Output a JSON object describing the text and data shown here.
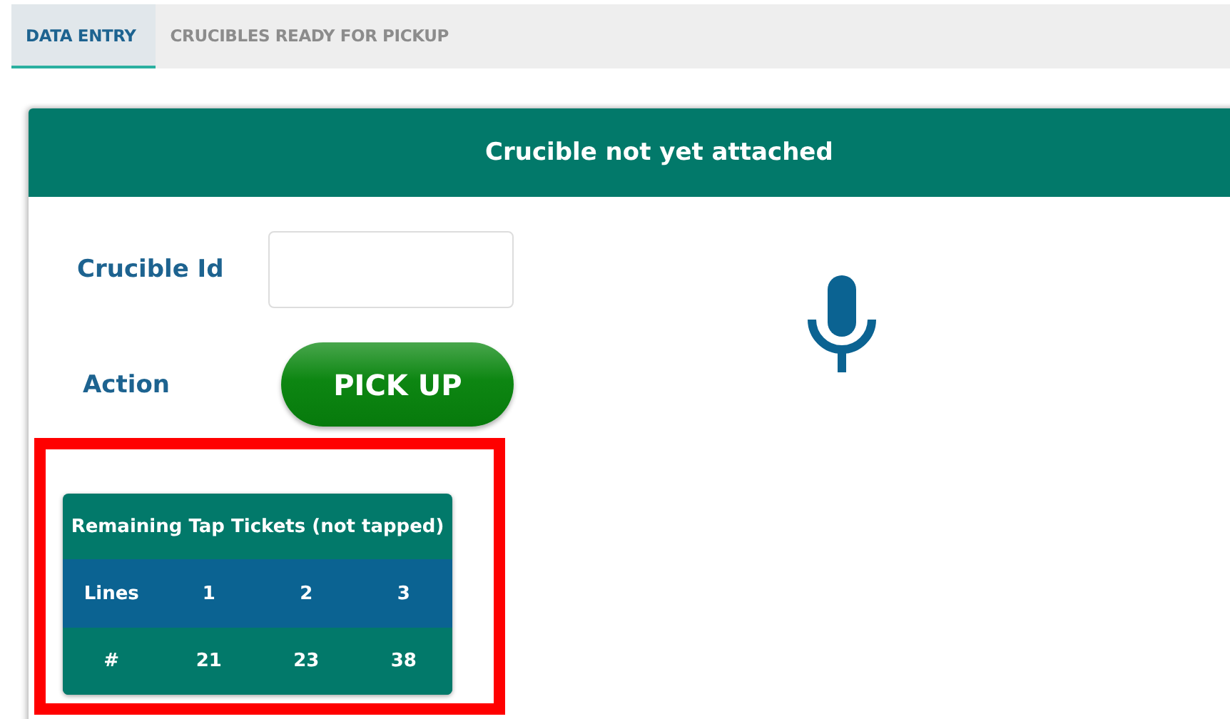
{
  "tabs": [
    {
      "label": "DATA ENTRY",
      "selected": true
    },
    {
      "label": "CRUCIBLES READY FOR PICKUP",
      "selected": false
    }
  ],
  "card": {
    "title": "Crucible not yet attached",
    "fields": [
      {
        "kind": "input",
        "label": "Crucible Id"
      },
      {
        "kind": "button",
        "label": "Action",
        "button": "PICK UP"
      }
    ],
    "tickets": {
      "highlighted": true,
      "title": "Remaining Tap Tickets (not tapped)",
      "rows": [
        {
          "kind": "head",
          "cells": [
            "Lines",
            "1",
            "2",
            "3"
          ]
        },
        {
          "kind": "body",
          "cells": [
            "#",
            "21",
            "23",
            "38"
          ]
        }
      ]
    }
  }
}
